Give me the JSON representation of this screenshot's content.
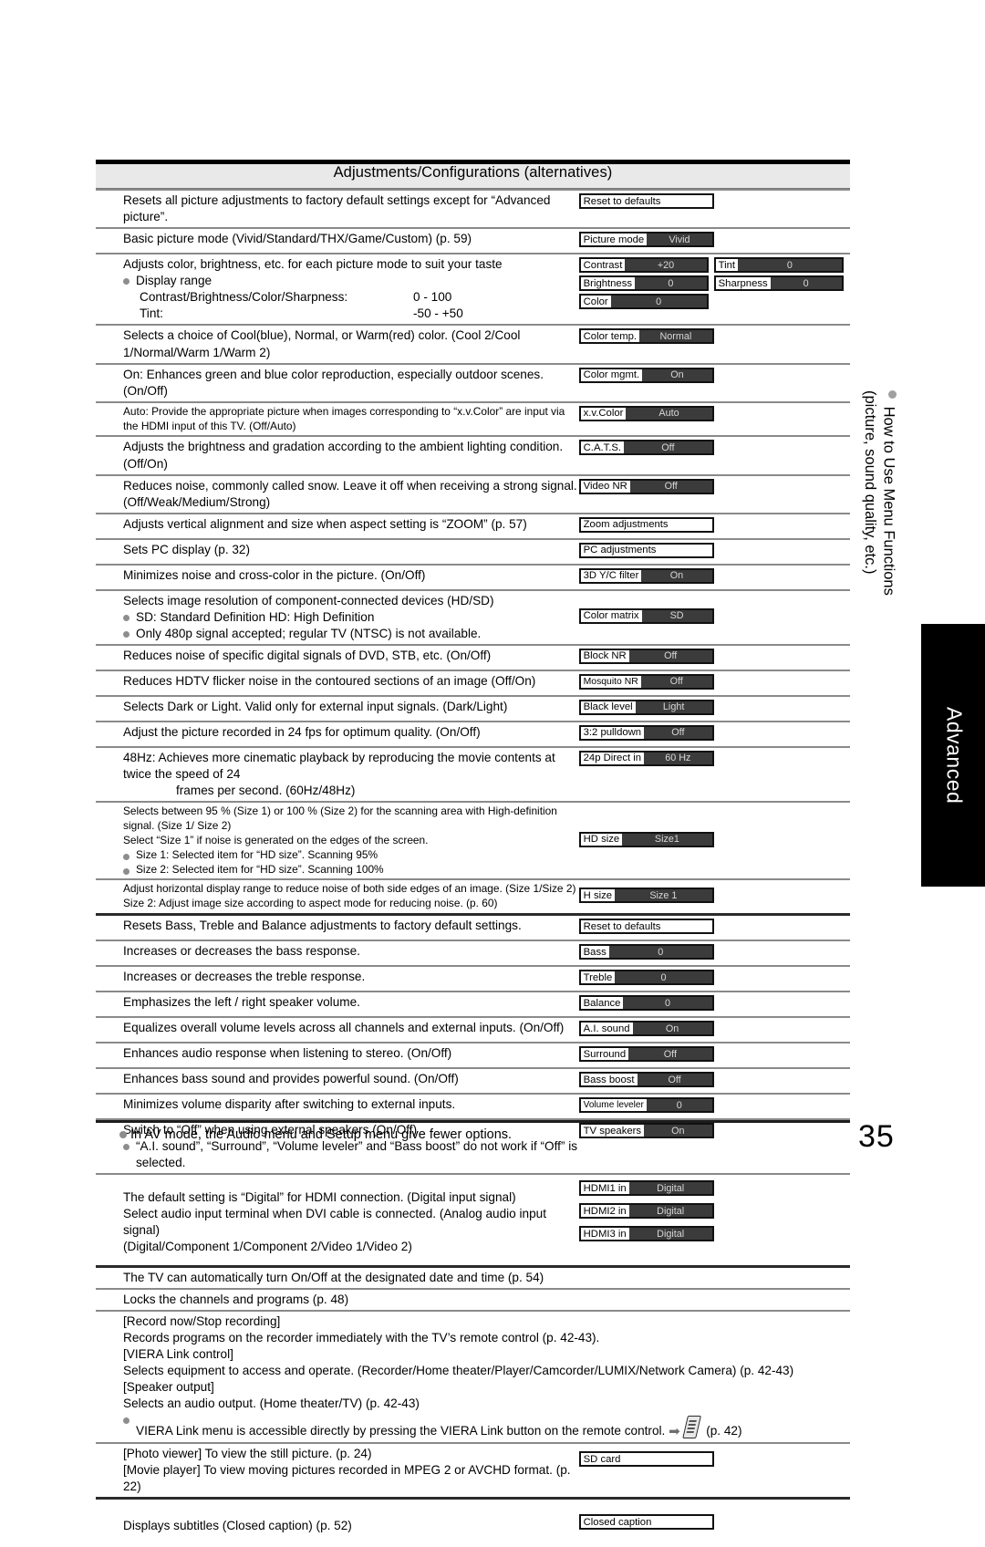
{
  "page": {
    "number": "35",
    "footer_note": "In AV mode, the Audio menu and Setup menu give fewer options."
  },
  "side": {
    "vertical_heading_line1": "How to Use Menu Functions",
    "vertical_heading_line2": "(picture, sound quality, etc.)",
    "tab_label": "Advanced"
  },
  "table": {
    "header": "Adjustments/Configurations (alternatives)",
    "rows": [
      {
        "desc": "Resets all picture adjustments to factory default settings except for “Advanced picture”.",
        "chips": [
          {
            "label": "Reset to defaults",
            "value": ""
          }
        ]
      },
      {
        "desc": "Basic picture mode (Vivid/Standard/THX/Game/Custom) (p. 59)",
        "chips": [
          {
            "label": "Picture mode",
            "value": "Vivid"
          }
        ]
      },
      {
        "desc": "Adjusts color, brightness, etc. for each picture mode to suit your taste",
        "sub_bullet": "Display range",
        "range_rows": [
          {
            "label": "Contrast/Brightness/Color/Sharpness:",
            "value": "0 - 100"
          },
          {
            "label": "Tint:",
            "value": "-50 - +50"
          }
        ],
        "chips_left": [
          {
            "label": "Contrast",
            "value": "+20"
          },
          {
            "label": "Brightness",
            "value": "0"
          },
          {
            "label": "Color",
            "value": "0"
          }
        ],
        "chips_right": [
          {
            "label": "Tint",
            "value": "0"
          },
          {
            "label": "Sharpness",
            "value": "0"
          }
        ]
      },
      {
        "desc": "Selects a choice of Cool(blue), Normal, or Warm(red) color. (Cool 2/Cool 1/Normal/Warm 1/Warm 2)",
        "chips": [
          {
            "label": "Color temp.",
            "value": "Normal"
          }
        ]
      },
      {
        "desc": "On:  Enhances green and blue color reproduction, especially outdoor scenes. (On/Off)",
        "chips": [
          {
            "label": "Color mgmt.",
            "value": "On"
          }
        ]
      },
      {
        "desc": "Auto: Provide the appropriate picture when images corresponding to “x.v.Color” are input via the HDMI input of this TV. (Off/Auto)",
        "small": true,
        "chips": [
          {
            "label": "x.v.Color",
            "value": "Auto"
          }
        ]
      },
      {
        "desc": "Adjusts the brightness and gradation according to the ambient lighting condition. (Off/On)",
        "chips": [
          {
            "label": "C.A.T.S.",
            "value": "Off"
          }
        ]
      },
      {
        "desc": "Reduces noise, commonly called snow. Leave it off when receiving a strong signal. (Off/Weak/Medium/Strong)",
        "chips": [
          {
            "label": "Video NR",
            "value": "Off"
          }
        ]
      },
      {
        "desc": "Adjusts vertical alignment and size when aspect setting is “ZOOM” (p. 57)",
        "chips": [
          {
            "label": "Zoom adjustments",
            "value": ""
          }
        ]
      },
      {
        "desc": "Sets PC display (p. 32)",
        "chips": [
          {
            "label": "PC adjustments",
            "value": ""
          }
        ]
      },
      {
        "desc": "Minimizes noise and cross-color in the picture. (On/Off)",
        "chips": [
          {
            "label": "3D Y/C filter",
            "value": "On"
          }
        ]
      },
      {
        "desc": "Selects image resolution of component-connected devices (HD/SD)",
        "bullets": [
          "SD:  Standard Definition        HD:  High Definition",
          "Only 480p signal accepted; regular TV (NTSC) is not available."
        ],
        "chips": [
          {
            "label": "Color matrix",
            "value": "SD"
          }
        ]
      },
      {
        "desc": "Reduces noise of specific digital signals of DVD, STB, etc. (On/Off)",
        "chips": [
          {
            "label": "Block NR",
            "value": "Off"
          }
        ]
      },
      {
        "desc": "Reduces HDTV flicker noise in the contoured sections of an image (Off/On)",
        "chips": [
          {
            "label": "Mosquito NR",
            "value": "Off"
          }
        ]
      },
      {
        "desc": "Selects Dark or Light. Valid only for external input signals. (Dark/Light)",
        "chips": [
          {
            "label": "Black level",
            "value": "Light"
          }
        ]
      },
      {
        "desc": "Adjust the picture recorded in 24 fps for optimum quality. (On/Off)",
        "chips": [
          {
            "label": "3:2 pulldown",
            "value": "Off"
          }
        ]
      },
      {
        "desc": "48Hz: Achieves more cinematic playback by reproducing the movie contents at twice the speed of 24",
        "cont": "frames per second. (60Hz/48Hz)",
        "chips": [
          {
            "label": "24p Direct in",
            "value": "60 Hz"
          }
        ]
      },
      {
        "desc": "Selects between 95 % (Size 1) or 100 % (Size 2) for the scanning area with High-definition signal. (Size 1/ Size 2)",
        "line2": "Select “Size 1” if noise is generated on the edges of the screen.",
        "bullets": [
          "Size 1: Selected item for “HD size”. Scanning 95%",
          "Size 2: Selected item for “HD size”. Scanning 100%"
        ],
        "small": true,
        "chips": [
          {
            "label": "HD size",
            "value": "Size1"
          }
        ]
      },
      {
        "desc": "Adjust horizontal display range to reduce noise of both side edges of an image. (Size 1/Size 2)",
        "line2": "Size 2: Adjust image size according to aspect mode for reducing noise. (p. 60)",
        "small": true,
        "chips": [
          {
            "label": "H size",
            "value": "Size 1"
          }
        ]
      },
      {
        "desc": "Resets Bass, Treble and Balance adjustments to factory default settings.",
        "chips": [
          {
            "label": "Reset to defaults",
            "value": ""
          }
        ]
      },
      {
        "desc": "Increases or decreases the bass response.",
        "chips": [
          {
            "label": "Bass",
            "value": "0"
          }
        ]
      },
      {
        "desc": "Increases or decreases the treble response.",
        "chips": [
          {
            "label": "Treble",
            "value": "0"
          }
        ]
      },
      {
        "desc": "Emphasizes the left / right speaker volume.",
        "chips": [
          {
            "label": "Balance",
            "value": "0"
          }
        ]
      },
      {
        "desc": "Equalizes overall volume levels across all channels and external inputs. (On/Off)",
        "chips": [
          {
            "label": "A.I. sound",
            "value": "On"
          }
        ]
      },
      {
        "desc": "Enhances audio response when listening to stereo. (On/Off)",
        "chips": [
          {
            "label": "Surround",
            "value": "Off"
          }
        ]
      },
      {
        "desc": "Enhances bass sound and provides powerful sound. (On/Off)",
        "chips": [
          {
            "label": "Bass boost",
            "value": "Off"
          }
        ]
      },
      {
        "desc": "Minimizes volume disparity after switching to external inputs.",
        "chips": [
          {
            "label": "Volume leveler",
            "value": "0"
          }
        ]
      },
      {
        "desc": "Switch to “Off” when using external speakers (On/Off)",
        "bullets": [
          "“A.I. sound”, “Surround”, “Volume leveler” and “Bass boost” do not work if “Off” is selected."
        ],
        "chips": [
          {
            "label": "TV speakers",
            "value": "On"
          }
        ]
      },
      {
        "desc": "The default setting is “Digital” for HDMI connection. (Digital input signal)",
        "line2": "Select audio input terminal when DVI cable is connected. (Analog audio input signal)",
        "line3": "(Digital/Component 1/Component 2/Video 1/Video 2)",
        "chips": [
          {
            "label": "HDMI1 in",
            "value": "Digital"
          },
          {
            "label": "HDMI2 in",
            "value": "Digital"
          },
          {
            "label": "HDMI3 in",
            "value": "Digital"
          }
        ]
      },
      {
        "desc": "The TV can automatically turn On/Off at the designated date and time (p. 54)",
        "chips": []
      },
      {
        "desc": "Locks the channels and programs (p. 48)",
        "chips": []
      },
      {
        "desc": "[Record now/Stop recording]",
        "lines": [
          "Records programs on the recorder immediately with the TV’s remote control (p. 42-43).",
          "[VIERA Link control]",
          "Selects equipment to access and operate. (Recorder/Home theater/Player/Camcorder/LUMIX/Network Camera) (p. 42-43)",
          "[Speaker output]",
          "Selects an audio output. (Home theater/TV) (p. 42-43)"
        ],
        "viera_bullet_before": "VIERA Link menu is accessible directly by pressing the VIERA Link button on the remote control.",
        "viera_bullet_after": "(p. 42)",
        "chips": []
      },
      {
        "desc": "[Photo viewer] To view the still picture. (p. 24)",
        "line2": "[Movie player] To view moving pictures recorded in MPEG 2 or AVCHD format. (p. 22)",
        "chips": [
          {
            "label": "SD card",
            "value": ""
          }
        ]
      },
      {
        "desc": "Displays subtitles (Closed caption) (p. 52)",
        "chips": [
          {
            "label": "Closed caption",
            "value": ""
          }
        ]
      }
    ]
  }
}
